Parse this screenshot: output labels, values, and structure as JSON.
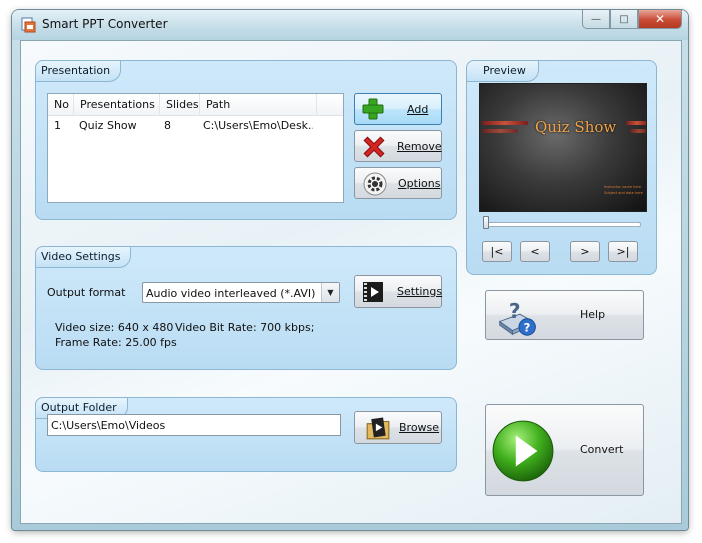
{
  "window": {
    "title": "Smart PPT Converter",
    "controls": {
      "minimize": "—",
      "maximize": "□",
      "close": "✕"
    }
  },
  "presentation": {
    "group_label": "Presentation",
    "columns": [
      "No",
      "Presentations",
      "Slides",
      "Path"
    ],
    "rows": [
      {
        "no": "1",
        "name": "Quiz Show",
        "slides": "8",
        "path": "C:\\Users\\Emo\\Desk..."
      }
    ],
    "add_label": "Add",
    "remove_label": "Remove",
    "options_label": "Options"
  },
  "video": {
    "group_label": "Video Settings",
    "output_format_label": "Output format",
    "output_format_value": "Audio video interleaved (*.AVI)",
    "settings_label": "Settings",
    "video_size": "Video size: 640 x 480",
    "bit_rate": "Video Bit Rate: 700 kbps;",
    "frame_rate": "Frame Rate: 25.00 fps"
  },
  "output": {
    "group_label": "Output Folder",
    "path_value": "C:\\Users\\Emo\\Videos",
    "browse_label": "Browse"
  },
  "preview": {
    "group_label": "Preview",
    "slide_title": "Quiz Show",
    "slide_sub1": "Instructor name here",
    "slide_sub2": "Subject and date here",
    "slider_position": 0,
    "nav": {
      "first": "|<",
      "prev": "<",
      "next": ">",
      "last": ">|"
    }
  },
  "help_label": "Help",
  "convert_label": "Convert",
  "colors": {
    "accent": "#3c7fb1",
    "panel": "#c4e2f6",
    "play_green": "#3fae1c",
    "remove_red": "#d42424"
  }
}
